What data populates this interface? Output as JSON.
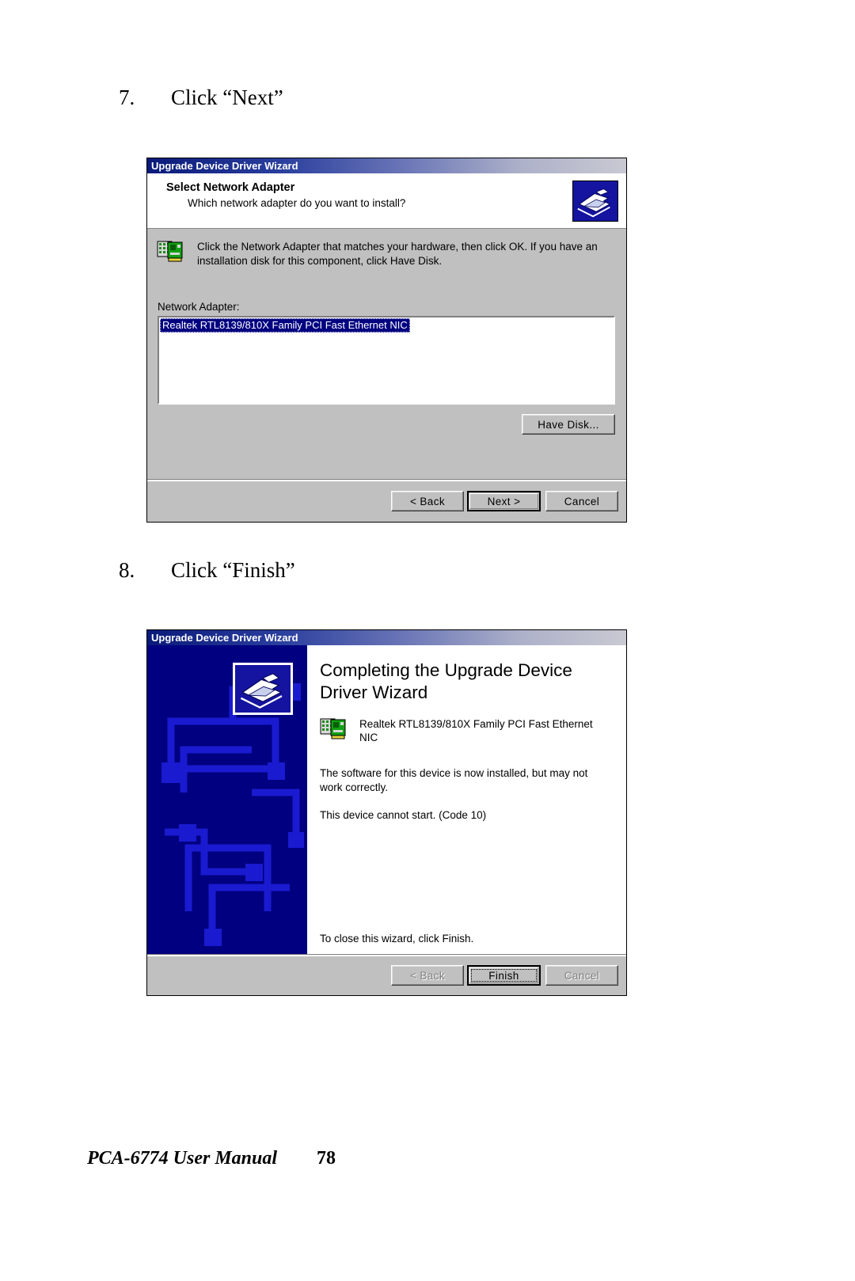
{
  "page": {
    "footer_title": "PCA-6774 User Manual",
    "footer_page_number": "78"
  },
  "steps": [
    {
      "number": "7.",
      "text": "Click “Next”"
    },
    {
      "number": "8.",
      "text": "Click “Finish”"
    }
  ],
  "dialog1": {
    "titlebar": "Upgrade Device Driver Wizard",
    "header_title": "Select Network Adapter",
    "header_subtitle": "Which network adapter do you want to install?",
    "logo_icon": "wizard-hand-icon",
    "info_icon": "network-card-icon",
    "info_text": "Click the Network Adapter that matches your hardware, then click OK. If you have an installation disk for this component, click Have Disk.",
    "list_label": "Network Adapter:",
    "list_items": [
      "Realtek RTL8139/810X Family PCI Fast Ethernet NIC"
    ],
    "selected_index": 0,
    "have_disk_label": "Have Disk...",
    "buttons": {
      "back": "< Back",
      "next": "Next >",
      "cancel": "Cancel"
    },
    "colors": {
      "title_start": "#0a1a7a",
      "title_end": "#c9c9d2",
      "face": "#c0c0c0",
      "selection": "#000080"
    }
  },
  "dialog2": {
    "titlebar": "Upgrade Device Driver Wizard",
    "wizard_icon": "wizard-hand-icon",
    "heading": "Completing the Upgrade Device Driver Wizard",
    "device_icon": "network-card-icon",
    "device_name": "Realtek RTL8139/810X Family PCI Fast Ethernet NIC",
    "status_text": "The software for this device is now installed, but may not work correctly.",
    "error_text": "This device cannot start. (Code 10)",
    "close_text": "To close this wizard, click Finish.",
    "buttons": {
      "back": "< Back",
      "finish": "Finish",
      "cancel": "Cancel"
    },
    "colors": {
      "left_panel": "#000080",
      "face": "#c0c0c0"
    }
  }
}
